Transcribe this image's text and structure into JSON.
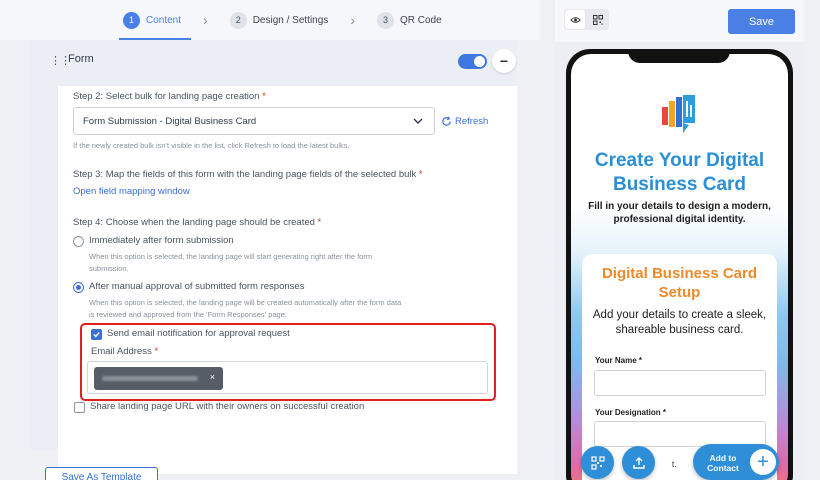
{
  "stepper": {
    "steps": [
      {
        "num": "1",
        "label": "Content"
      },
      {
        "num": "2",
        "label": "Design / Settings"
      },
      {
        "num": "3",
        "label": "QR Code"
      }
    ]
  },
  "form": {
    "title": "Form",
    "enabled": true,
    "step2": {
      "label": "Step 2: Select bulk for landing page creation",
      "required_mark": "*",
      "selected": "Form Submission - Digital Business Card",
      "refresh_label": "Refresh",
      "hint": "If the newly created bulk isn't visible in the list, click Refresh to load the latest bulks."
    },
    "step3": {
      "label": "Step 3: Map the fields of this form with the landing page fields of the selected bulk",
      "required_mark": "*",
      "link": "Open field mapping window"
    },
    "step4": {
      "label": "Step 4: Choose when the landing page should be created",
      "required_mark": "*",
      "options": [
        {
          "label": "Immediately after form submission",
          "hint_line1": "When this option is selected, the landing page will start generating right after the form",
          "hint_line2": "submission.",
          "selected": false
        },
        {
          "label": "After manual approval of submitted form responses",
          "hint_line1": "When this option is selected, the landing page will be created automatically after the form data",
          "hint_line2": "is reviewed and approved from the 'Form Responses' page.",
          "selected": true
        }
      ]
    },
    "notify": {
      "label": "Send email notification for approval request",
      "checked": true,
      "email_label": "Email Address",
      "required_mark": "*",
      "chip_remove": "×"
    },
    "share": {
      "label": "Share landing page URL with their owners on successful creation",
      "checked": false
    },
    "save_template": "Save As Template"
  },
  "preview": {
    "save_label": "Save",
    "hero_title": "Create Your Digital Business Card",
    "hero_subtitle": "Fill in your details to design a modern, professional digital identity.",
    "card_title": "Digital Business Card Setup",
    "card_subtitle": "Add your details to create a sleek, shareable business card.",
    "fields": [
      {
        "label": "Your Name *"
      },
      {
        "label": "Your Designation *"
      }
    ],
    "partial_text": "t.",
    "add_contact": "Add to Contact",
    "plus": "+"
  },
  "colors": {
    "primary": "#4a80e6",
    "link": "#3a6fd8",
    "required": "#d0342c",
    "highlight": "#e02020",
    "hero_title": "#2b8fd6",
    "card_title": "#ee8a2c"
  }
}
